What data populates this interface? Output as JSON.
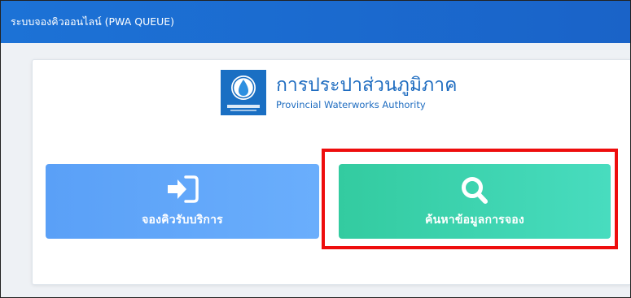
{
  "header": {
    "title": "ระบบจองคิวออนไลน์ (PWA QUEUE)"
  },
  "org": {
    "name_th": "การประปาส่วนภูมิภาค",
    "name_en": "Provincial Waterworks Authority",
    "logo_icon": "pwa-logo-icon"
  },
  "actions": {
    "book": {
      "label": "จองคิวรับบริการ",
      "icon": "sign-in-icon",
      "color": "#5aa0f7"
    },
    "search": {
      "label": "ค้นหาข้อมูลการจอง",
      "icon": "search-icon",
      "color": "#3fd3b0"
    }
  },
  "highlight": {
    "color": "#ee0d0d"
  }
}
